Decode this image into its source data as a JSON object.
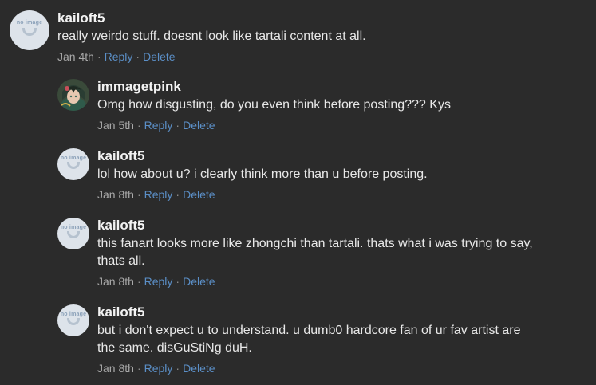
{
  "comments": [
    {
      "username": "kailoft5",
      "text": "really weirdo stuff. doesnt look like tartali content at all.",
      "date": "Jan 4th",
      "reply_label": "Reply",
      "delete_label": "Delete",
      "avatar_text": "no image"
    },
    {
      "username": "immagetpink",
      "text": "Omg how disgusting, do you even think before posting??? Kys",
      "date": "Jan 5th",
      "reply_label": "Reply",
      "delete_label": "Delete"
    },
    {
      "username": "kailoft5",
      "text": "lol how about u? i clearly think more than u before posting.",
      "date": "Jan 8th",
      "reply_label": "Reply",
      "delete_label": "Delete",
      "avatar_text": "no image"
    },
    {
      "username": "kailoft5",
      "text": "this fanart looks more like zhongchi than tartali. thats what i was trying to say,\nthats all.",
      "date": "Jan 8th",
      "reply_label": "Reply",
      "delete_label": "Delete",
      "avatar_text": "no image"
    },
    {
      "username": "kailoft5",
      "text": "but i don't expect u to understand. u dumb0 hardcore fan of ur fav artist are\nthe same. disGuStiNg duH.",
      "date": "Jan 8th",
      "reply_label": "Reply",
      "delete_label": "Delete",
      "avatar_text": "no image"
    }
  ],
  "separator": "·",
  "colors": {
    "background": "#2b2b2b",
    "link": "#5b8fc7",
    "meta": "#a9a9a9"
  }
}
